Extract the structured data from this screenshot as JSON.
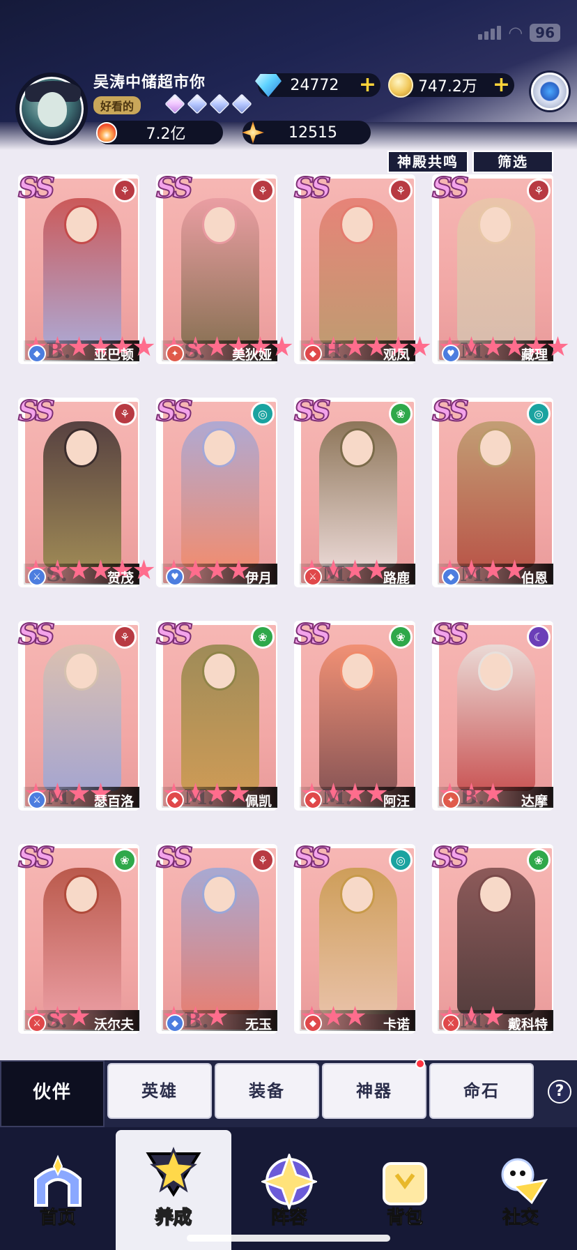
{
  "status": {
    "battery": "96"
  },
  "profile": {
    "name": "吴涛中储超市你",
    "title_badge": "好看的",
    "gem_levels": 4,
    "power": "7.2亿",
    "stars": "12515"
  },
  "currency": {
    "diamonds": "24772",
    "gold": "747.2万"
  },
  "filters": {
    "temple_resonance": "神殿共鸣",
    "filter": "筛选"
  },
  "colors": {
    "card_bg": "#f6b7b4",
    "star": "#ff6d8d",
    "fire": "#b83a42",
    "wind": "#1aa3a0",
    "nature": "#2fa84a",
    "moon": "#6b3fb8"
  },
  "heroes": [
    {
      "rank": "SS",
      "element": "fire",
      "stars": 6,
      "role": "shield",
      "letter": "B.",
      "name": "亚巴顿"
    },
    {
      "rank": "SS",
      "element": "fire",
      "stars": 6,
      "role": "mage",
      "letter": "S.",
      "name": "美狄娅"
    },
    {
      "rank": "SS",
      "element": "fire",
      "stars": 6,
      "role": "tank",
      "letter": "H.",
      "name": "观凤"
    },
    {
      "rank": "SS",
      "element": "fire",
      "stars": 6,
      "role": "support",
      "letter": "M.",
      "name": "藏理"
    },
    {
      "rank": "SS",
      "element": "fire",
      "stars": 6,
      "role": "assassin",
      "letter": "S.",
      "name": "贺茂"
    },
    {
      "rank": "SS",
      "element": "wind",
      "stars": 4,
      "role": "support",
      "letter": "",
      "name": "伊月"
    },
    {
      "rank": "SS",
      "element": "nature",
      "stars": 4,
      "role": "warrior",
      "letter": "M.",
      "name": "路鹿"
    },
    {
      "rank": "SS",
      "element": "wind",
      "stars": 4,
      "role": "shield",
      "letter": "M.",
      "name": "伯恩"
    },
    {
      "rank": "SS",
      "element": "fire",
      "stars": 4,
      "role": "assassin",
      "letter": "M.",
      "name": "瑟百洛"
    },
    {
      "rank": "SS",
      "element": "nature",
      "stars": 4,
      "role": "tank",
      "letter": "M.",
      "name": "佩凯"
    },
    {
      "rank": "SS",
      "element": "nature",
      "stars": 4,
      "role": "tank",
      "letter": "M.",
      "name": "阿汪"
    },
    {
      "rank": "SS",
      "element": "moon",
      "stars": 3,
      "role": "mage",
      "letter": "B.",
      "name": "达摩"
    },
    {
      "rank": "SS",
      "element": "nature",
      "stars": 3,
      "role": "warrior",
      "letter": "S.",
      "name": "沃尔夫"
    },
    {
      "rank": "SS",
      "element": "fire",
      "stars": 3,
      "role": "shield",
      "letter": "B.",
      "name": "无玉"
    },
    {
      "rank": "SS",
      "element": "wind",
      "stars": 3,
      "role": "tank",
      "letter": "",
      "name": "卡诺"
    },
    {
      "rank": "SS",
      "element": "nature",
      "stars": 3,
      "role": "warrior",
      "letter": "M.",
      "name": "戴科特"
    }
  ],
  "subtabs": [
    {
      "label": "伙伴",
      "active": true
    },
    {
      "label": "英雄"
    },
    {
      "label": "装备"
    },
    {
      "label": "神器",
      "badge": true
    },
    {
      "label": "命石"
    }
  ],
  "help": "?",
  "nav": [
    {
      "label": "首页",
      "icon": "home-arch-icon"
    },
    {
      "label": "养成",
      "icon": "star-triangle-icon",
      "active": true
    },
    {
      "label": "阵容",
      "icon": "compass-star-icon"
    },
    {
      "label": "背包",
      "icon": "bag-icon"
    },
    {
      "label": "社交",
      "icon": "ghost-mail-icon"
    }
  ]
}
